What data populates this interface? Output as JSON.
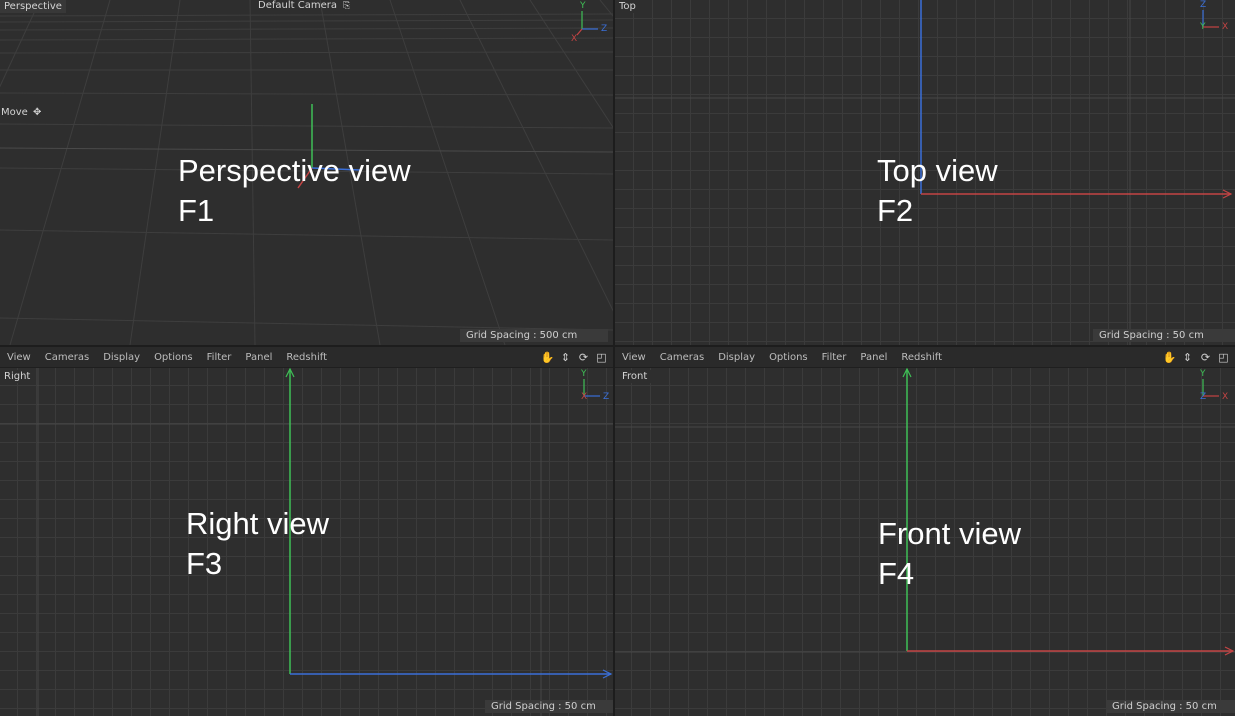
{
  "menu": [
    "View",
    "Cameras",
    "Display",
    "Options",
    "Filter",
    "Panel",
    "Redshift"
  ],
  "tool_icons": [
    "hand-icon",
    "move-view-icon",
    "rotate-view-icon",
    "maximize-view-icon"
  ],
  "perspective": {
    "name": "Perspective",
    "camera": "Default Camera",
    "camera_icon": "camera-lock-icon",
    "tool": "Move",
    "tool_icon": "move-cross-icon",
    "grid_spacing": "Grid Spacing : 500 cm",
    "title": "Perspective view",
    "key": "F1",
    "axes": {
      "y": "Y",
      "x": "X",
      "z": "Z"
    }
  },
  "top": {
    "name": "Top",
    "grid_spacing": "Grid Spacing : 50 cm",
    "title": "Top view",
    "key": "F2",
    "axes": {
      "z": "Z",
      "y": "Y",
      "x": "X"
    }
  },
  "right": {
    "name": "Right",
    "grid_spacing": "Grid Spacing : 50 cm",
    "title": "Right view",
    "key": "F3",
    "axes": {
      "y": "Y",
      "x": "X",
      "z": "Z"
    }
  },
  "front": {
    "name": "Front",
    "grid_spacing": "Grid Spacing : 50 cm",
    "title": "Front view",
    "key": "F4",
    "axes": {
      "y": "Y",
      "z": "Z",
      "x": "X"
    }
  },
  "colors": {
    "x_axis": "#c44444",
    "y_axis": "#3fbf56",
    "z_axis": "#3a6fd8",
    "background": "#2e2e2e",
    "grid": "#3b3b3b"
  }
}
